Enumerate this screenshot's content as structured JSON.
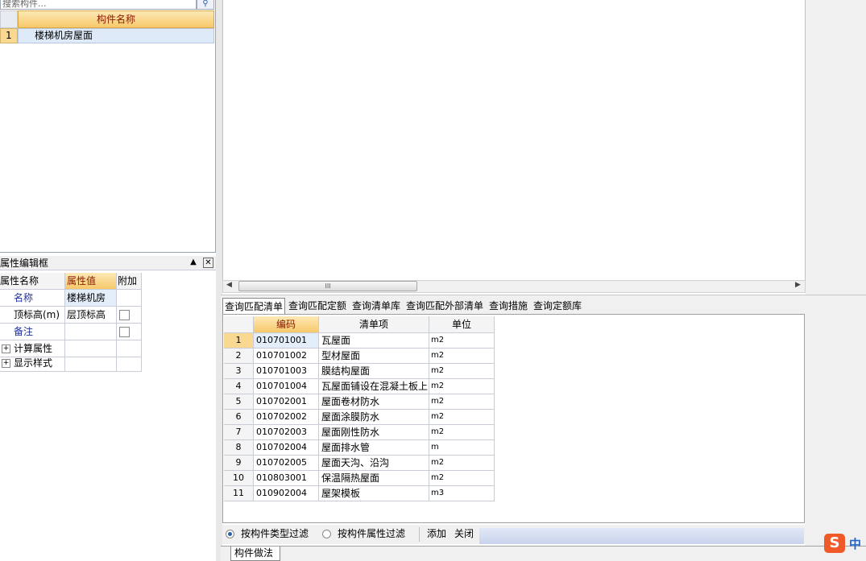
{
  "search": {
    "placeholder": "搜索构件...",
    "icon": "search-icon"
  },
  "component_list": {
    "header": "构件名称",
    "rows": [
      {
        "num": "1",
        "name": "楼梯机房屋面"
      }
    ]
  },
  "property_panel": {
    "title": "属性编辑框",
    "pin_symbol": "ᚹ",
    "close_symbol": "✕",
    "headers": {
      "name": "属性名称",
      "value": "属性值",
      "extra": "附加"
    },
    "rows": [
      {
        "name": "名称",
        "value": "楼梯机房",
        "blue": true,
        "has_check": false
      },
      {
        "name": "顶标高(m)",
        "value": "层顶标高",
        "blue": false,
        "has_check": true
      },
      {
        "name": "备注",
        "value": "",
        "blue": true,
        "has_check": true
      },
      {
        "name": "计算属性",
        "value": "",
        "blue": false,
        "expand": true
      },
      {
        "name": "显示样式",
        "value": "",
        "blue": false,
        "expand": true
      }
    ]
  },
  "scrollbar": {
    "grip": "III",
    "left_arrow": "◀",
    "right_arrow": "▶"
  },
  "tabs": [
    "查询匹配清单",
    "查询匹配定额",
    "查询清单库",
    "查询匹配外部清单",
    "查询措施",
    "查询定额库"
  ],
  "query_table": {
    "headers": {
      "code": "编码",
      "item": "清单项",
      "unit": "单位"
    },
    "rows": [
      {
        "num": "1",
        "code": "010701001",
        "item": "瓦屋面",
        "unit": "m2"
      },
      {
        "num": "2",
        "code": "010701002",
        "item": "型材屋面",
        "unit": "m2"
      },
      {
        "num": "3",
        "code": "010701003",
        "item": "膜结构屋面",
        "unit": "m2"
      },
      {
        "num": "4",
        "code": "010701004",
        "item": "瓦屋面铺设在混凝土板上",
        "unit": "m2"
      },
      {
        "num": "5",
        "code": "010702001",
        "item": "屋面卷材防水",
        "unit": "m2"
      },
      {
        "num": "6",
        "code": "010702002",
        "item": "屋面涂膜防水",
        "unit": "m2"
      },
      {
        "num": "7",
        "code": "010702003",
        "item": "屋面刚性防水",
        "unit": "m2"
      },
      {
        "num": "8",
        "code": "010702004",
        "item": "屋面排水管",
        "unit": "m"
      },
      {
        "num": "9",
        "code": "010702005",
        "item": "屋面天沟、沿沟",
        "unit": "m2"
      },
      {
        "num": "10",
        "code": "010803001",
        "item": "保温隔热屋面",
        "unit": "m2"
      },
      {
        "num": "11",
        "code": "010902004",
        "item": "屋架模板",
        "unit": "m3"
      }
    ]
  },
  "filter": {
    "by_type": "按构件类型过滤",
    "by_attr": "按构件属性过滤",
    "add": "添加",
    "close": "关闭"
  },
  "bottom_tab": "构件做法",
  "ime": {
    "logo": "S",
    "label": "中"
  }
}
